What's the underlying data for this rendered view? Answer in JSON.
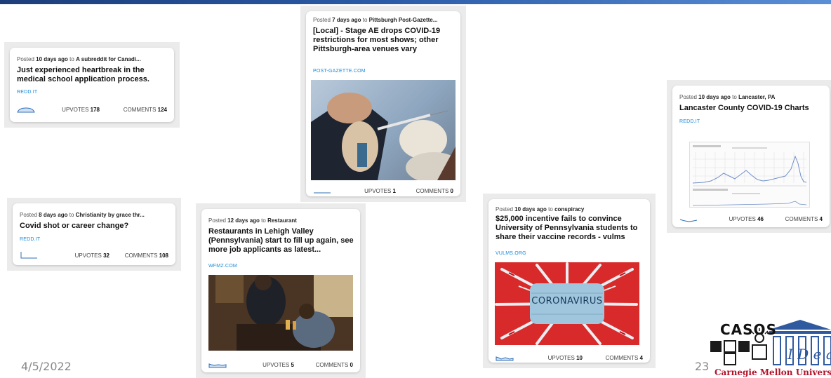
{
  "slide": {
    "date": "4/5/2022",
    "page": "23"
  },
  "logo": {
    "text": "CASOS",
    "institution": "Carnegie Mellon University"
  },
  "posts": [
    {
      "posted_prefix": "Posted ",
      "age": "10 days ago",
      "to": " to ",
      "community": "A subreddit for Canadi...",
      "title": "Just experienced heartbreak in the medical school application process.",
      "domain": "REDD.IT",
      "upvotes_label": "UPVOTES",
      "upvotes": "178",
      "comments_label": "COMMENTS",
      "comments": "124"
    },
    {
      "posted_prefix": "Posted ",
      "age": "7 days ago",
      "to": " to ",
      "community": "Pittsburgh Post-Gazette...",
      "title": "[Local] - Stage AE drops COVID-19 restrictions for most shows; other Pittsburgh-area venues vary",
      "domain": "POST-GAZETTE.COM",
      "upvotes_label": "UPVOTES",
      "upvotes": "1",
      "comments_label": "COMMENTS",
      "comments": "0"
    },
    {
      "posted_prefix": "Posted ",
      "age": "10 days ago",
      "to": " to ",
      "community": "Lancaster, PA",
      "title": "Lancaster County COVID-19 Charts",
      "domain": "REDD.IT",
      "upvotes_label": "UPVOTES",
      "upvotes": "46",
      "comments_label": "COMMENTS",
      "comments": "4"
    },
    {
      "posted_prefix": "Posted ",
      "age": "8 days ago",
      "to": " to ",
      "community": "Christianity by grace thr...",
      "title": "Covid shot or career change?",
      "domain": "REDD.IT",
      "upvotes_label": "UPVOTES",
      "upvotes": "32",
      "comments_label": "COMMENTS",
      "comments": "108"
    },
    {
      "posted_prefix": "Posted ",
      "age": "12 days ago",
      "to": " to ",
      "community": "Restaurant",
      "title": "Restaurants in Lehigh Valley (Pennsylvania) start to fill up again, see more job applicants as latest...",
      "domain": "WFMZ.COM",
      "upvotes_label": "UPVOTES",
      "upvotes": "5",
      "comments_label": "COMMENTS",
      "comments": "0"
    },
    {
      "posted_prefix": "Posted ",
      "age": "10 days ago",
      "to": " to ",
      "community": "conspiracy",
      "title": "$25,000 incentive fails to convince University of Pennsylvania students to share their vaccine records - vulms",
      "domain": "VULMS.ORG",
      "upvotes_label": "UPVOTES",
      "upvotes": "10",
      "comments_label": "COMMENTS",
      "comments": "4",
      "image_text": "CORONAVIRUS"
    }
  ],
  "colors": {
    "accent": "#1a8ad6",
    "sparkline": "#2f6fb5",
    "background": "#ffffff"
  }
}
